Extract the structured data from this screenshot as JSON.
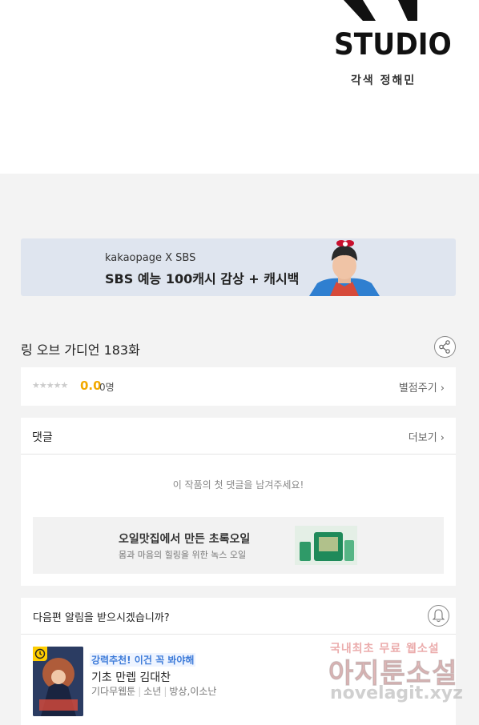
{
  "studio": {
    "logo_text": "STUDIO",
    "credit": "각색 정해민"
  },
  "banner": {
    "sub": "kakaopage X SBS",
    "main": "SBS 예능 100캐시 감상 + 캐시백"
  },
  "episode": {
    "title": "링 오브 가디언 183화"
  },
  "rating": {
    "stars": "★★★★★",
    "score": "0.0",
    "count": "0명",
    "action": "별점주기 ›"
  },
  "comments": {
    "title": "댓글",
    "more": "더보기 ›",
    "empty": "이 작품의 첫 댓글을 남겨주세요!",
    "ad": {
      "title": "오일맛집에서 만든 초록오일",
      "sub": "몸과 마음의 힐링을 위한 녹스 오일"
    }
  },
  "notify": {
    "question": "다음편 알림을 받으시겠습니까?"
  },
  "recommendation": {
    "tag": "강력추천! 이건 꼭 봐야해",
    "title": "기초 만렙 김대찬",
    "meta": [
      "기다무웹툰",
      "소년",
      "방상,이소난"
    ]
  },
  "watermark": {
    "top": "국내최초 무료 웹소설",
    "mid": "아지툰소설",
    "bottom": "novelagit.xyz"
  },
  "colors": {
    "score": "#f2a900",
    "tag": "#3d7bd9",
    "banner_bg": "#dfe5ef"
  }
}
